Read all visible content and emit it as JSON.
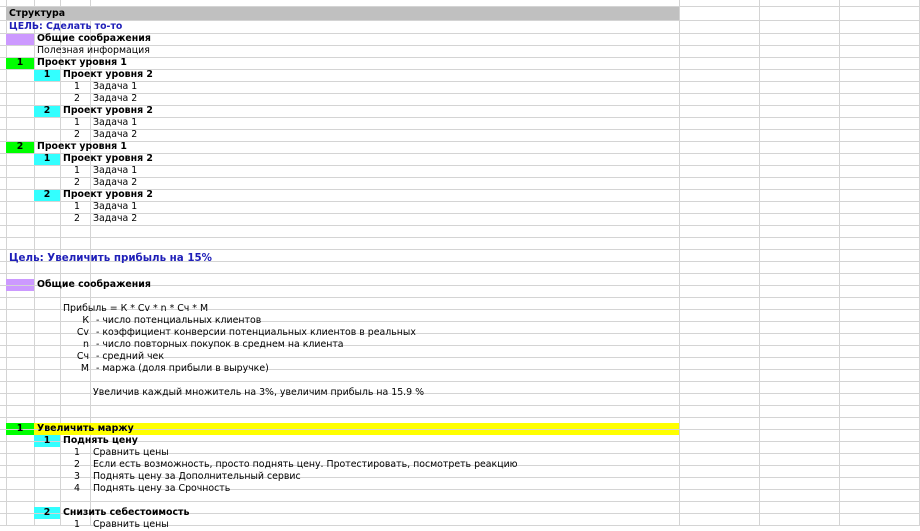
{
  "sheet": {
    "title": "Структура",
    "goal1": "ЦЕЛЬ: Сделать то-то",
    "general_considerations": "Общие соображения",
    "useful_info": "Полезная информация",
    "level1_project": "Проект уровня 1",
    "level2_project": "Проект уровня 2",
    "task1": "Задача 1",
    "task2": "Задача 2",
    "n1": "1",
    "n2": "2",
    "n3": "3",
    "n4": "4",
    "goal2": "Цель: Увеличить прибыль на 15%",
    "general_considerations2": "Общие соображения",
    "formula": "Прибыль = К * Cv * n * Сч * М",
    "vars": [
      {
        "sym": "К",
        "desc": "- число потенциальных клиентов"
      },
      {
        "sym": "Cv",
        "desc": "- коэффициент конверсии потенциальных клиентов в реальных"
      },
      {
        "sym": "n",
        "desc": "- число повторных покупок в среднем на клиента"
      },
      {
        "sym": "Сч",
        "desc": "- средний чек"
      },
      {
        "sym": "М",
        "desc": "- маржа (доля прибыли в выручке)"
      }
    ],
    "conclusion": "Увеличив каждый множитель на 3%, увеличим прибыль на 15.9 %",
    "increase_margin": "Увеличить маржу",
    "raise_price": "Поднять цену",
    "tasks_price": [
      "Сравнить цены",
      "Если есть возможность, просто поднять цену. Протестировать, посмотреть реакцию",
      "Поднять цену за Дополнительный сервис",
      "Поднять цену за Срочность"
    ],
    "reduce_cost": "Снизить себестоимость",
    "last_task": "Сравнить цены"
  },
  "colors": {
    "header_gray": "#c0c0c0",
    "purple": "#cc99ff",
    "green": "#00ff00",
    "cyan": "#33ffff",
    "yellow": "#ffff00",
    "grid": "#d4d4d4",
    "goal_blue": "#1f1fb8"
  }
}
